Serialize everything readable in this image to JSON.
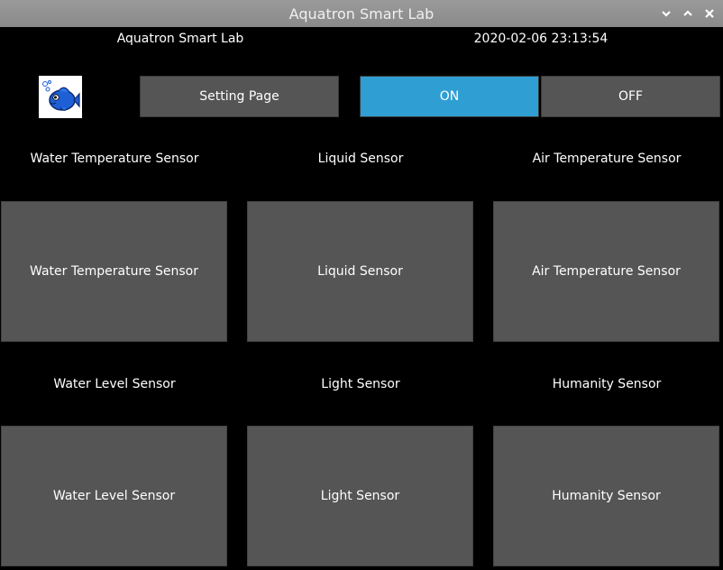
{
  "window": {
    "title": "Aquatron Smart Lab",
    "controls": [
      "minimize-icon",
      "maximize-icon",
      "close-icon"
    ]
  },
  "header": {
    "app_name": "Aquatron Smart Lab",
    "datetime": "2020-02-06 23:13:54"
  },
  "toolbar": {
    "logo_icon": "fish-icon",
    "setting_label": "Setting Page",
    "on_label": "ON",
    "off_label": "OFF",
    "on_color": "#2f9fd3"
  },
  "sensors": {
    "row1": [
      {
        "label": "Water Temperature Sensor",
        "value": "Water Temperature Sensor"
      },
      {
        "label": "Liquid Sensor",
        "value": "Liquid Sensor"
      },
      {
        "label": "Air Temperature Sensor",
        "value": "Air Temperature Sensor"
      }
    ],
    "row2": [
      {
        "label": "Water Level Sensor",
        "value": "Water Level Sensor"
      },
      {
        "label": "Light Sensor",
        "value": "Light Sensor"
      },
      {
        "label": "Humanity Sensor",
        "value": "Humanity Sensor"
      }
    ]
  }
}
